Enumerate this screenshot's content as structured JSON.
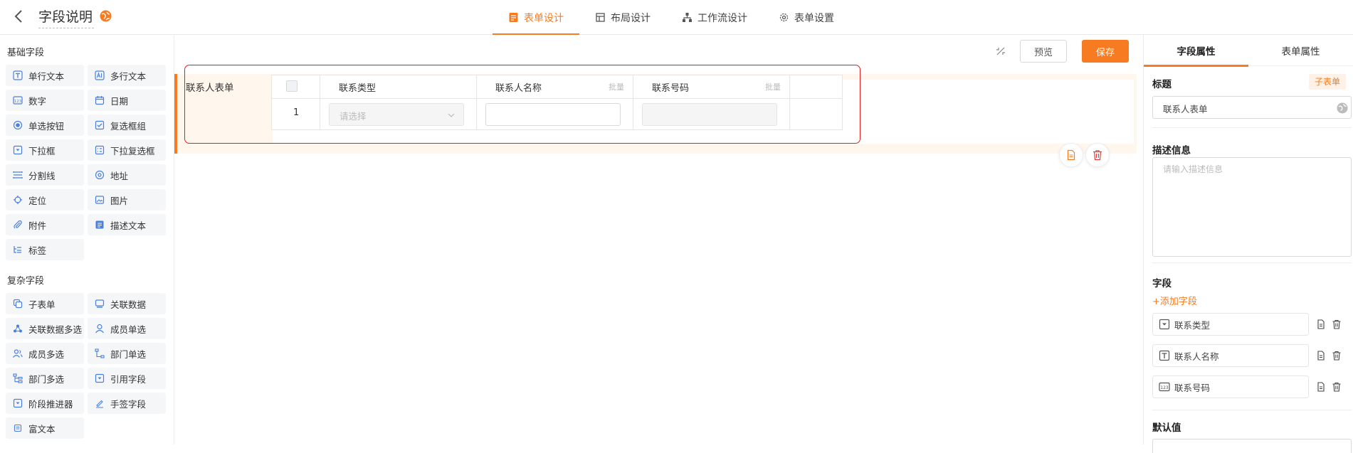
{
  "header": {
    "title": "字段说明",
    "tabs": [
      {
        "label": "表单设计",
        "active": true,
        "icon": "form-icon"
      },
      {
        "label": "布局设计",
        "active": false,
        "icon": "layout-icon"
      },
      {
        "label": "工作流设计",
        "active": false,
        "icon": "workflow-icon"
      },
      {
        "label": "表单设置",
        "active": false,
        "icon": "gear-icon"
      }
    ]
  },
  "palette": {
    "basic_title": "基础字段",
    "basic": [
      {
        "label": "单行文本",
        "icon": "text-icon"
      },
      {
        "label": "多行文本",
        "icon": "multiline-text-icon"
      },
      {
        "label": "数字",
        "icon": "number-icon"
      },
      {
        "label": "日期",
        "icon": "calendar-icon"
      },
      {
        "label": "单选按钮",
        "icon": "radio-icon"
      },
      {
        "label": "复选框组",
        "icon": "checkbox-icon"
      },
      {
        "label": "下拉框",
        "icon": "dropdown-icon"
      },
      {
        "label": "下拉复选框",
        "icon": "dropdown-checkbox-icon"
      },
      {
        "label": "分割线",
        "icon": "divider-icon"
      },
      {
        "label": "地址",
        "icon": "location-pin-icon"
      },
      {
        "label": "定位",
        "icon": "crosshair-icon"
      },
      {
        "label": "图片",
        "icon": "image-icon"
      },
      {
        "label": "附件",
        "icon": "paperclip-icon"
      },
      {
        "label": "描述文本",
        "icon": "description-icon"
      },
      {
        "label": "标签",
        "icon": "tag-icon"
      }
    ],
    "complex_title": "复杂字段",
    "complex": [
      {
        "label": "子表单",
        "icon": "subform-icon"
      },
      {
        "label": "关联数据",
        "icon": "linked-data-icon"
      },
      {
        "label": "关联数据多选",
        "icon": "linked-multi-icon"
      },
      {
        "label": "成员单选",
        "icon": "user-icon"
      },
      {
        "label": "成员多选",
        "icon": "users-icon"
      },
      {
        "label": "部门单选",
        "icon": "department-icon"
      },
      {
        "label": "部门多选",
        "icon": "departments-icon"
      },
      {
        "label": "引用字段",
        "icon": "reference-icon"
      },
      {
        "label": "阶段推进器",
        "icon": "stage-icon"
      },
      {
        "label": "手签字段",
        "icon": "signature-icon"
      },
      {
        "label": "富文本",
        "icon": "rich-text-icon"
      }
    ]
  },
  "canvas": {
    "preview_label": "预览",
    "save_label": "保存",
    "subform": {
      "label": "联系人表单",
      "columns": [
        {
          "label": "联系类型",
          "batch": ""
        },
        {
          "label": "联系人名称",
          "batch": "批量"
        },
        {
          "label": "联系号码",
          "batch": "批量"
        }
      ],
      "row_number": "1",
      "select_placeholder": "请选择"
    }
  },
  "right_panel": {
    "tabs": [
      {
        "label": "字段属性",
        "active": true
      },
      {
        "label": "表单属性",
        "active": false
      }
    ],
    "title_label": "标题",
    "type_badge": "子表单",
    "title_value": "联系人表单",
    "desc_label": "描述信息",
    "desc_placeholder": "请输入描述信息",
    "fields_label": "字段",
    "add_field": "+添加字段",
    "fields": [
      {
        "label": "联系类型",
        "icon": "dropdown-icon"
      },
      {
        "label": "联系人名称",
        "icon": "text-icon"
      },
      {
        "label": "联系号码",
        "icon": "number-icon"
      }
    ],
    "default_label": "默认值"
  },
  "colors": {
    "accent": "#f77b20",
    "highlight": "#e02020",
    "icon": "#4a7fe0"
  }
}
